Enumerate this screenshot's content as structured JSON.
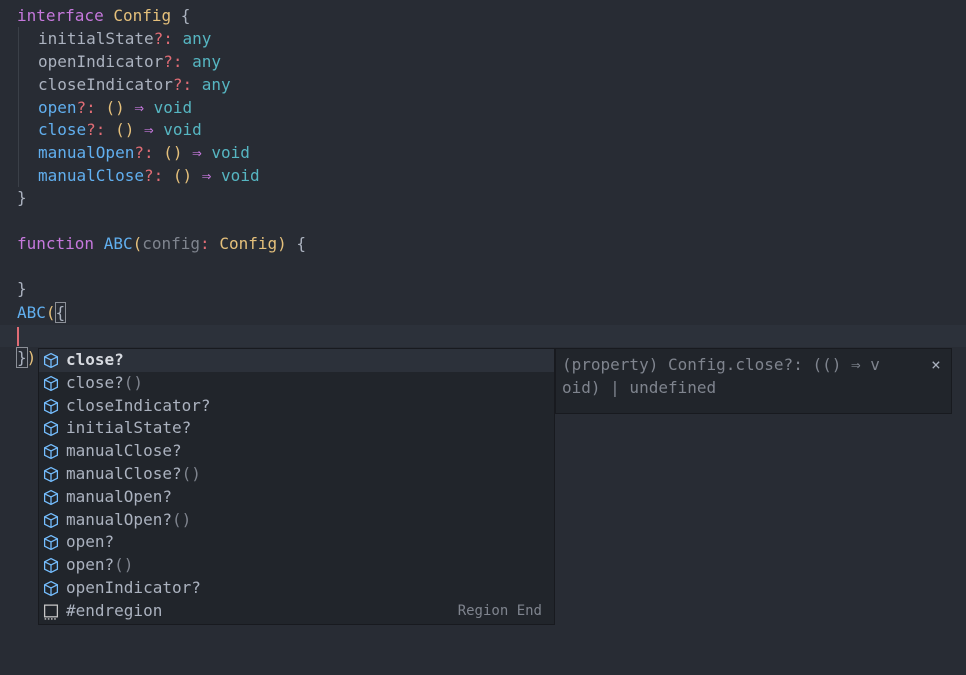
{
  "code": {
    "l1": {
      "kw": "interface",
      "name": "Config",
      "brace": " {"
    },
    "props": [
      {
        "name": "initialState",
        "sep": "?: ",
        "type": "any"
      },
      {
        "name": "openIndicator",
        "sep": "?: ",
        "type": "any"
      },
      {
        "name": "closeIndicator",
        "sep": "?: ",
        "type": "any"
      }
    ],
    "methods": [
      {
        "name": "open",
        "sep": "?: ",
        "parens": "()",
        "arrow": " ⇒ ",
        "ret": "void"
      },
      {
        "name": "close",
        "sep": "?: ",
        "parens": "()",
        "arrow": " ⇒ ",
        "ret": "void"
      },
      {
        "name": "manualOpen",
        "sep": "?: ",
        "parens": "()",
        "arrow": " ⇒ ",
        "ret": "void"
      },
      {
        "name": "manualClose",
        "sep": "?: ",
        "parens": "()",
        "arrow": " ⇒ ",
        "ret": "void"
      }
    ],
    "close_brace": "}",
    "fn_line": {
      "kw": "function",
      "name": "ABC",
      "open": "(",
      "param": "config",
      "colon": ": ",
      "type": "Config",
      "close": ")",
      "brace": " {"
    },
    "fn_close": "}",
    "call_line": {
      "name": "ABC",
      "paren": "(",
      "brace": "{"
    },
    "end_line": {
      "brace": "}",
      "paren": ")"
    }
  },
  "suggest": {
    "items": [
      {
        "label": "close?",
        "suffix": "",
        "icon": "property-icon",
        "selected": true,
        "detail": ""
      },
      {
        "label": "close?",
        "suffix": "()",
        "icon": "property-icon",
        "selected": false,
        "detail": ""
      },
      {
        "label": "closeIndicator?",
        "suffix": "",
        "icon": "property-icon",
        "selected": false,
        "detail": ""
      },
      {
        "label": "initialState?",
        "suffix": "",
        "icon": "property-icon",
        "selected": false,
        "detail": ""
      },
      {
        "label": "manualClose?",
        "suffix": "",
        "icon": "property-icon",
        "selected": false,
        "detail": ""
      },
      {
        "label": "manualClose?",
        "suffix": "()",
        "icon": "property-icon",
        "selected": false,
        "detail": ""
      },
      {
        "label": "manualOpen?",
        "suffix": "",
        "icon": "property-icon",
        "selected": false,
        "detail": ""
      },
      {
        "label": "manualOpen?",
        "suffix": "()",
        "icon": "property-icon",
        "selected": false,
        "detail": ""
      },
      {
        "label": "open?",
        "suffix": "",
        "icon": "property-icon",
        "selected": false,
        "detail": ""
      },
      {
        "label": "open?",
        "suffix": "()",
        "icon": "property-icon",
        "selected": false,
        "detail": ""
      },
      {
        "label": "openIndicator?",
        "suffix": "",
        "icon": "property-icon",
        "selected": false,
        "detail": ""
      },
      {
        "label": "#endregion",
        "suffix": "",
        "icon": "snippet-icon",
        "selected": false,
        "detail": "Region End"
      }
    ]
  },
  "details": {
    "line1": "(property) Config.close?: (() ⇒ v",
    "line2": "oid) | undefined",
    "close_glyph": "×"
  },
  "colors": {
    "background": "#282c34",
    "keyword": "#c678dd",
    "type": "#e5c07b",
    "property": "#e06c75",
    "function": "#61afef",
    "builtin": "#56b6c2"
  }
}
